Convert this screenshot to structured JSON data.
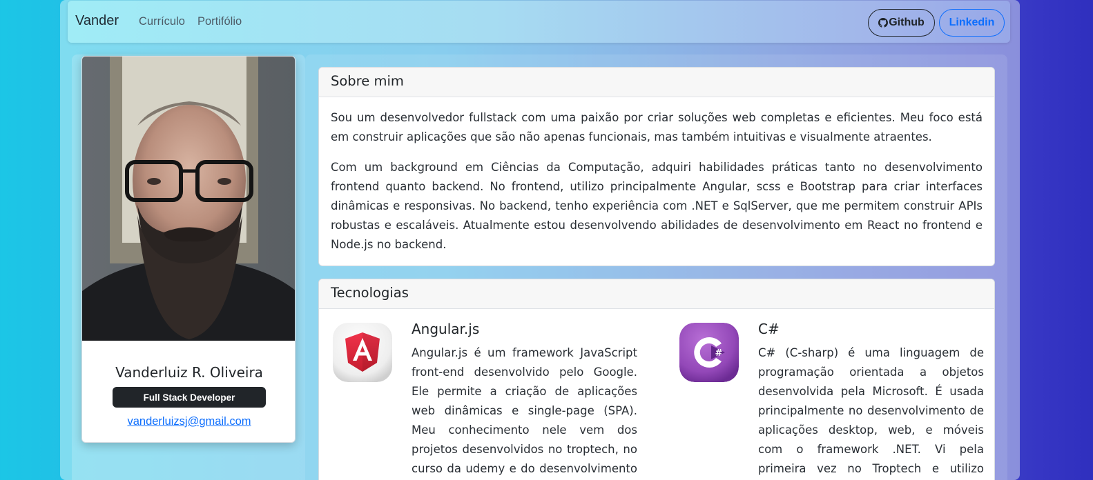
{
  "navbar": {
    "brand": "Vander",
    "links": [
      "Currículo",
      "Portifólio"
    ],
    "github_label": "Github",
    "linkedin_label": "Linkedin"
  },
  "profile": {
    "name": "Vanderluiz R. Oliveira",
    "role": "Full Stack Developer",
    "email": "vanderluizsj@gmail.com"
  },
  "about": {
    "title": "Sobre mim",
    "paragraphs": [
      "Sou um desenvolvedor fullstack com uma paixão por criar soluções web completas e eficientes. Meu foco está em construir aplicações que são não apenas funcionais, mas também intuitivas e visualmente atraentes.",
      "Com um background em Ciências da Computação, adquiri habilidades práticas tanto no desenvolvimento frontend quanto backend. No frontend, utilizo principalmente Angular, scss e Bootstrap para criar interfaces dinâmicas e responsivas. No backend, tenho experiência com .NET e SqlServer, que me permitem construir APIs robustas e escaláveis. Atualmente estou desenvolvendo abilidades de desenvolvimento em React no frontend e Node.js no backend."
    ]
  },
  "technologies": {
    "title": "Tecnologias",
    "items": [
      {
        "name": "Angular.js",
        "icon": "angular-logo-icon",
        "description": "Angular.js é um framework JavaScript front-end desenvolvido pelo Google. Ele permite a criação de aplicações web dinâmicas e single-page (SPA). Meu conhecimento nele vem dos projetos desenvolvidos no troptech, no curso da udemy e do desenvolvimento do meu"
      },
      {
        "name": "C#",
        "icon": "csharp-logo-icon",
        "description": "C# (C-sharp) é uma linguagem de programação orientada a objetos desenvolvida pela Microsoft. É usada principalmente no desenvolvimento de aplicações desktop, web, e móveis com o framework .NET. Vi pela primeira vez no Troptech e utilizo desde então na"
      }
    ]
  },
  "colors": {
    "primary": "#0d6efd",
    "dark": "#212529",
    "background_start": "#1cc6e6",
    "background_end": "#2f2fbe"
  }
}
